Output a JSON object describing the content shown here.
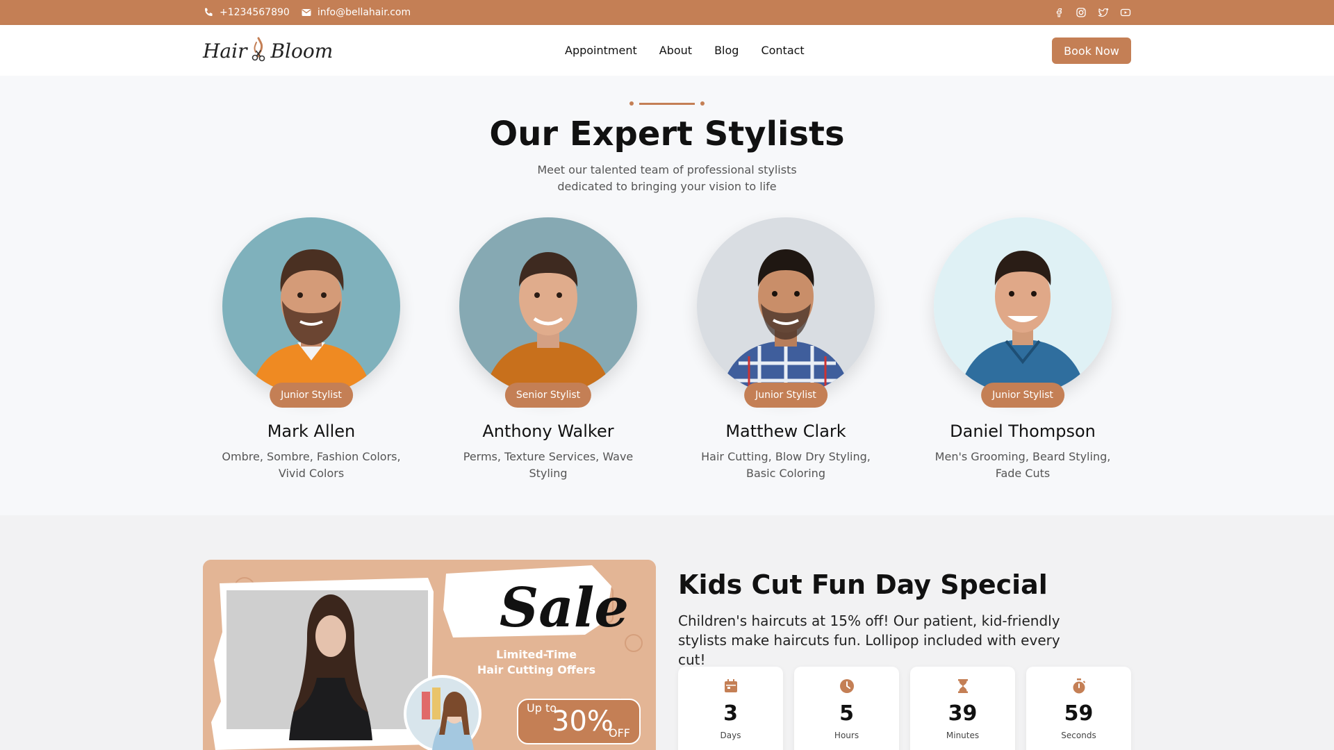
{
  "topbar": {
    "phone": "+1234567890",
    "email": "info@bellahair.com",
    "social_icons": [
      "facebook-icon",
      "instagram-icon",
      "twitter-icon",
      "youtube-icon"
    ]
  },
  "brand": {
    "logo_left": "Hair",
    "logo_right": "Bloom"
  },
  "nav": {
    "items": [
      "Appointment",
      "About",
      "Blog",
      "Contact"
    ],
    "cta": "Book Now"
  },
  "colors": {
    "accent": "#c47f55",
    "text": "#111111",
    "muted": "#555555",
    "background": "#f7f8fa"
  },
  "stylists_section": {
    "title": "Our Expert Stylists",
    "subtitle": "Meet our talented team of professional stylists dedicated to bringing your vision to life",
    "stylists": [
      {
        "name": "Mark Allen",
        "role": "Junior Stylist",
        "specialties": "Ombre, Sombre, Fashion Colors, Vivid Colors"
      },
      {
        "name": "Anthony Walker",
        "role": "Senior Stylist",
        "specialties": "Perms, Texture Services, Wave Styling"
      },
      {
        "name": "Matthew Clark",
        "role": "Junior Stylist",
        "specialties": "Hair Cutting, Blow Dry Styling, Basic Coloring"
      },
      {
        "name": "Daniel Thompson",
        "role": "Junior Stylist",
        "specialties": "Men's Grooming, Beard Styling, Fade Cuts"
      }
    ]
  },
  "promo": {
    "image": {
      "sale_text": "Sale",
      "offer_line1": "Limited-Time",
      "offer_line2": "Hair Cutting Offers",
      "badge_prefix": "Up to",
      "badge_value": "30%",
      "badge_suffix": "OFF"
    },
    "title": "Kids Cut Fun Day Special",
    "description": "Children's haircuts at 15% off! Our patient, kid-friendly stylists make haircuts fun. Lollipop included with every cut!",
    "countdown": [
      {
        "value": "3",
        "label": "Days",
        "icon": "calendar-icon"
      },
      {
        "value": "5",
        "label": "Hours",
        "icon": "clock-icon"
      },
      {
        "value": "39",
        "label": "Minutes",
        "icon": "hourglass-icon"
      },
      {
        "value": "59",
        "label": "Seconds",
        "icon": "stopwatch-icon"
      }
    ]
  }
}
